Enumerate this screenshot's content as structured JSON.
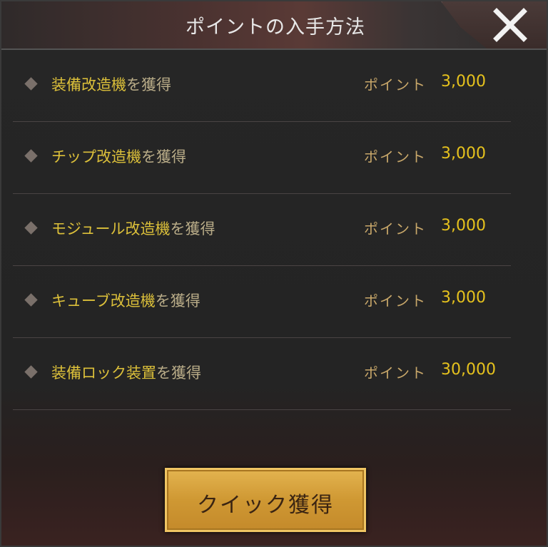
{
  "dialog": {
    "title": "ポイントの入手方法",
    "close_icon": "close-x-icon"
  },
  "points_label": "ポイント",
  "tasks": [
    {
      "item": "装備改造機",
      "suffix": "を獲得",
      "points": "3,000"
    },
    {
      "item": "チップ改造機",
      "suffix": "を獲得",
      "points": "3,000"
    },
    {
      "item": "モジュール改造機",
      "suffix": "を獲得",
      "points": "3,000"
    },
    {
      "item": "キューブ改造機",
      "suffix": "を獲得",
      "points": "3,000"
    },
    {
      "item": "装備ロック装置",
      "suffix": "を獲得",
      "points": "30,000"
    }
  ],
  "quick_button": {
    "label": "クイック獲得"
  },
  "colors": {
    "item_text": "#dcc03a",
    "suffix_text": "#b9ac88",
    "points_value": "#e6c21d",
    "button_gold": "#cf9833"
  }
}
